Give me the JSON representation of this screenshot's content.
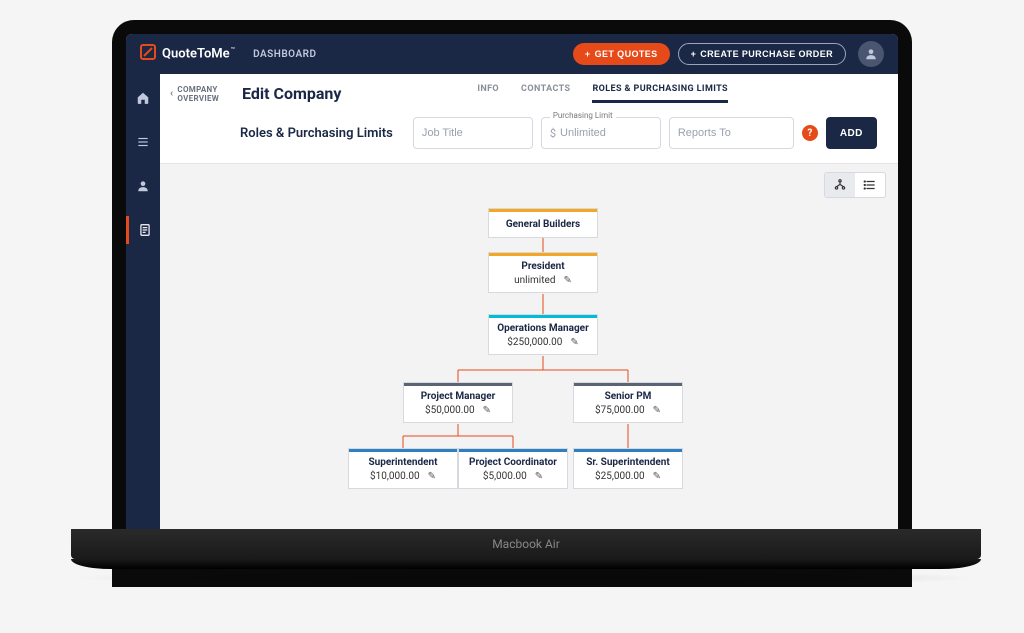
{
  "brand": {
    "name": "QuoteToMe",
    "tm": "™"
  },
  "topbar": {
    "breadcrumb": "DASHBOARD",
    "get_quotes": "GET QUOTES",
    "create_po": "CREATE PURCHASE ORDER"
  },
  "back_link": {
    "line1": "COMPANY",
    "line2": "OVERVIEW"
  },
  "page": {
    "title": "Edit Company"
  },
  "tabs": {
    "info": "INFO",
    "contacts": "CONTACTS",
    "roles": "ROLES & PURCHASING LIMITS"
  },
  "section": {
    "title": "Roles & Purchasing Limits"
  },
  "fields": {
    "job_title_placeholder": "Job Title",
    "limit_label": "Purchasing Limit",
    "limit_prefix": "$",
    "limit_placeholder": "Unlimited",
    "reports_to_placeholder": "Reports To"
  },
  "buttons": {
    "add": "ADD"
  },
  "laptop": {
    "label": "Macbook Air"
  },
  "org": {
    "root": {
      "title": "General Builders"
    },
    "president": {
      "title": "President",
      "value": "unlimited"
    },
    "ops_mgr": {
      "title": "Operations Manager",
      "value": "$250,000.00"
    },
    "proj_mgr": {
      "title": "Project Manager",
      "value": "$50,000.00"
    },
    "senior_pm": {
      "title": "Senior PM",
      "value": "$75,000.00"
    },
    "superintendent": {
      "title": "Superintendent",
      "value": "$10,000.00"
    },
    "proj_coord": {
      "title": "Project Coordinator",
      "value": "$5,000.00"
    },
    "sr_superintendent": {
      "title": "Sr. Superintendent",
      "value": "$25,000.00"
    }
  },
  "colors": {
    "orange": "#f5a623",
    "red": "#e64a19",
    "teal": "#00bcd4",
    "slate": "#5a6475",
    "blue": "#2e7fbf"
  }
}
